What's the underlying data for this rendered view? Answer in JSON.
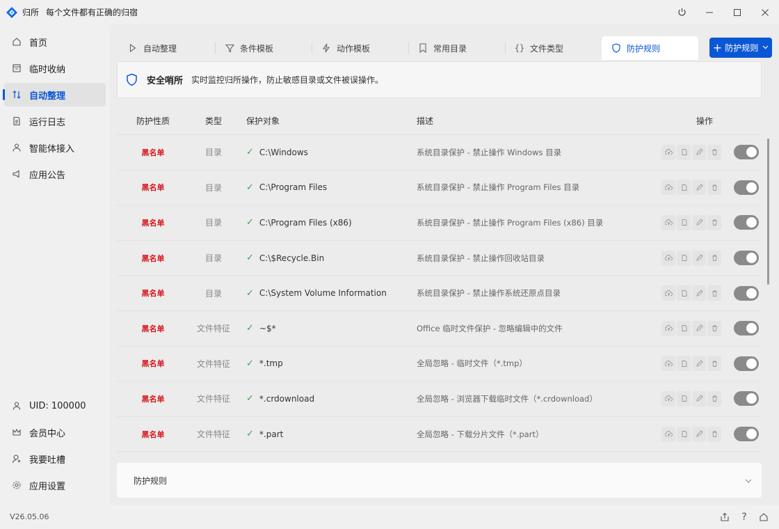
{
  "app": {
    "name": "归所",
    "slogan": "每个文件都有正确的归宿",
    "version": "V26.05.06"
  },
  "sidebar": {
    "top_items": [
      {
        "label": "首页",
        "icon": "home-icon"
      },
      {
        "label": "临时收纳",
        "icon": "inbox-icon"
      },
      {
        "label": "自动整理",
        "icon": "sort-arrows-icon",
        "active": true
      },
      {
        "label": "运行日志",
        "icon": "log-icon"
      },
      {
        "label": "智能体接入",
        "icon": "agent-icon"
      },
      {
        "label": "应用公告",
        "icon": "announcement-icon"
      }
    ],
    "bottom_items": [
      {
        "label": "UID: 100000",
        "icon": "user-icon"
      },
      {
        "label": "会员中心",
        "icon": "crown-icon"
      },
      {
        "label": "我要吐槽",
        "icon": "feedback-icon"
      },
      {
        "label": "应用设置",
        "icon": "settings-icon"
      }
    ]
  },
  "tabs": [
    {
      "label": "自动整理",
      "icon": "play-icon"
    },
    {
      "label": "条件模板",
      "icon": "filter-icon"
    },
    {
      "label": "动作模板",
      "icon": "bolt-icon"
    },
    {
      "label": "常用目录",
      "icon": "bookmark-icon"
    },
    {
      "label": "文件类型",
      "icon": "braces-icon"
    },
    {
      "label": "防护规则",
      "icon": "shield-icon",
      "active": true
    }
  ],
  "add_button": {
    "label": "防护规则"
  },
  "banner": {
    "title": "安全哨所",
    "text": "实时监控归所操作，防止敏感目录或文件被误操作。"
  },
  "table": {
    "headers": {
      "nature": "防护性质",
      "type": "类型",
      "target": "保护对象",
      "desc": "描述",
      "ops": "操作"
    },
    "rows": [
      {
        "nature": "黑名单",
        "type": "目录",
        "target": "C:\\Windows",
        "desc": "系统目录保护 - 禁止操作 Windows 目录",
        "enabled": true
      },
      {
        "nature": "黑名单",
        "type": "目录",
        "target": "C:\\Program Files",
        "desc": "系统目录保护 - 禁止操作 Program Files 目录",
        "enabled": true
      },
      {
        "nature": "黑名单",
        "type": "目录",
        "target": "C:\\Program Files (x86)",
        "desc": "系统目录保护 - 禁止操作 Program Files (x86) 目录",
        "enabled": true
      },
      {
        "nature": "黑名单",
        "type": "目录",
        "target": "C:\\$Recycle.Bin",
        "desc": "系统目录保护 - 禁止操作回收站目录",
        "enabled": true
      },
      {
        "nature": "黑名单",
        "type": "目录",
        "target": "C:\\System Volume Information",
        "desc": "系统目录保护 - 禁止操作系统还原点目录",
        "enabled": true
      },
      {
        "nature": "黑名单",
        "type": "文件特征",
        "target": "~$*",
        "desc": "Office 临时文件保护 - 忽略编辑中的文件",
        "enabled": true
      },
      {
        "nature": "黑名单",
        "type": "文件特征",
        "target": "*.tmp",
        "desc": "全局忽略 - 临时文件（*.tmp）",
        "enabled": true
      },
      {
        "nature": "黑名单",
        "type": "文件特征",
        "target": "*.crdownload",
        "desc": "全局忽略 - 浏览器下载临时文件（*.crdownload）",
        "enabled": true
      },
      {
        "nature": "黑名单",
        "type": "文件特征",
        "target": "*.part",
        "desc": "全局忽略 - 下载分片文件（*.part）",
        "enabled": true
      }
    ]
  },
  "panel": {
    "title": "防护规则"
  },
  "colors": {
    "accent": "#0a57d6",
    "blacklist": "#d6141c",
    "check": "#2fa84f"
  }
}
